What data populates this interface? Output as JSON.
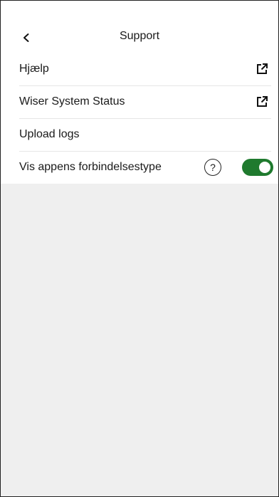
{
  "header": {
    "title": "Support",
    "back_icon": "chevron-left-icon"
  },
  "list": {
    "items": [
      {
        "label": "Hjælp",
        "icon": "external-link-icon"
      },
      {
        "label": "Wiser System Status",
        "icon": "external-link-icon"
      },
      {
        "label": "Upload logs"
      },
      {
        "label": "Vis appens forbindelsestype",
        "help_icon": "?",
        "toggle_on": true
      }
    ]
  },
  "colors": {
    "accent": "#1f7a2e",
    "page_background": "#efefef",
    "card_background": "#ffffff"
  }
}
